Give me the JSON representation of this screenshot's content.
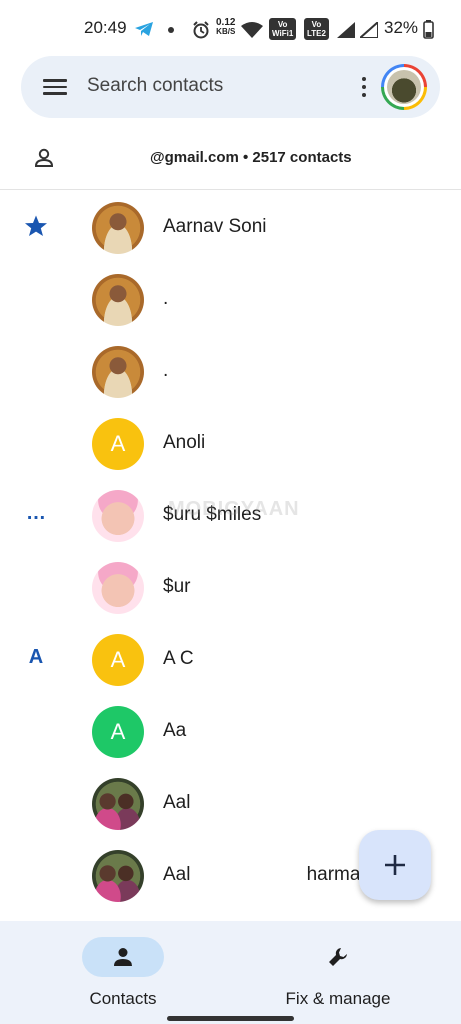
{
  "status_bar": {
    "time": "20:49",
    "network_speed_value": "0.12",
    "network_speed_unit": "KB/S",
    "volte1_top": "Vo",
    "volte1_bottom": "WiFi1",
    "volte2_top": "Vo",
    "volte2_bottom": "LTE2",
    "battery": "32%"
  },
  "search": {
    "placeholder": "Search contacts"
  },
  "account": {
    "text": "@gmail.com • 2517 contacts"
  },
  "contacts": [
    {
      "section": "star",
      "avatar": "photo-man",
      "name": "Aarnav Soni",
      "color": ""
    },
    {
      "section": "",
      "avatar": "photo-man",
      "name": ".",
      "color": ""
    },
    {
      "section": "",
      "avatar": "photo-man",
      "name": ".",
      "color": ""
    },
    {
      "section": "",
      "avatar": "letter",
      "letter": "A",
      "name": "Anoli",
      "color": "#f9c20f"
    },
    {
      "section": "…",
      "avatar": "photo-baby",
      "name": "$uru $miles",
      "color": ""
    },
    {
      "section": "",
      "avatar": "photo-baby",
      "name": "$ur",
      "color": ""
    },
    {
      "section": "A",
      "avatar": "letter",
      "letter": "A",
      "name": "A C",
      "color": "#f9c20f"
    },
    {
      "section": "",
      "avatar": "letter",
      "letter": "A",
      "name": "Aa",
      "color": "#1ec867"
    },
    {
      "section": "",
      "avatar": "photo-girls",
      "name": "Aal",
      "color": ""
    },
    {
      "section": "",
      "avatar": "photo-girls",
      "name": "Aal                      harma",
      "color": ""
    }
  ],
  "watermark": "MOBIGYAAN",
  "bottom_nav": {
    "contacts_label": "Contacts",
    "fix_label": "Fix & manage"
  },
  "colors": {
    "accent": "#1a56b0",
    "fab_bg": "#d8e4fb",
    "nav_bg": "#edf2fa",
    "search_bg": "#eaf0f8"
  }
}
